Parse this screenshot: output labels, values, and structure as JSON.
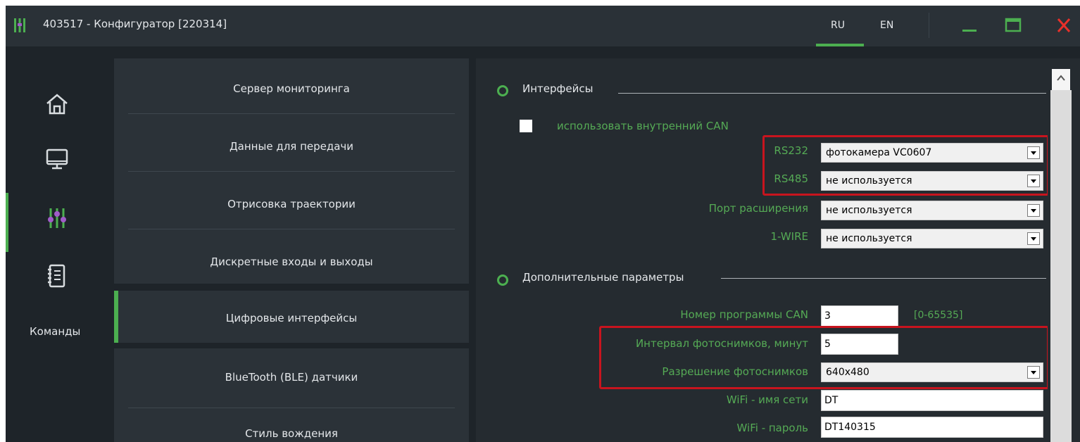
{
  "window": {
    "title": "403517 - Конфигуратор [220314]",
    "languages": [
      "RU",
      "EN"
    ],
    "active_language": "RU",
    "accent_color": "#4caf50",
    "highlight_color": "#c8141e"
  },
  "rail": {
    "items": [
      {
        "icon": "home-icon"
      },
      {
        "icon": "monitor-icon"
      },
      {
        "icon": "sliders-icon",
        "active": true
      },
      {
        "icon": "notebook-icon"
      }
    ],
    "commands_label": "Команды"
  },
  "menu": {
    "items": [
      {
        "label": "Сервер мониторинга"
      },
      {
        "label": "Данные для передачи"
      },
      {
        "label": "Отрисовка траектории"
      },
      {
        "label": "Дискретные входы и выходы"
      },
      {
        "label": "Цифровые интерфейсы",
        "active": true
      },
      {
        "label": "BlueTooth (BLE) датчики"
      },
      {
        "label": "Стиль вождения"
      }
    ]
  },
  "content": {
    "section_interfaces": "Интерфейсы",
    "use_internal_can": {
      "label": "использовать внутренний CAN",
      "checked": false
    },
    "rs232": {
      "label": "RS232",
      "value": "фотокамера VC0607"
    },
    "rs485": {
      "label": "RS485",
      "value": "не используется"
    },
    "expansion_port": {
      "label": "Порт расширения",
      "value": "не используется"
    },
    "one_wire": {
      "label": "1-WIRE",
      "value": "не используется"
    },
    "section_additional": "Дополнительные параметры",
    "can_program": {
      "label": "Номер программы CAN",
      "value": "3",
      "range": "[0-65535]"
    },
    "photo_interval": {
      "label": "Интервал фотоснимков, минут",
      "value": "5"
    },
    "photo_resolution": {
      "label": "Разрешение фотоснимков",
      "value": "640x480"
    },
    "wifi_ssid": {
      "label": "WiFi - имя сети",
      "value": "DT"
    },
    "wifi_password": {
      "label": "WiFi - пароль",
      "value": "DT140315"
    }
  }
}
